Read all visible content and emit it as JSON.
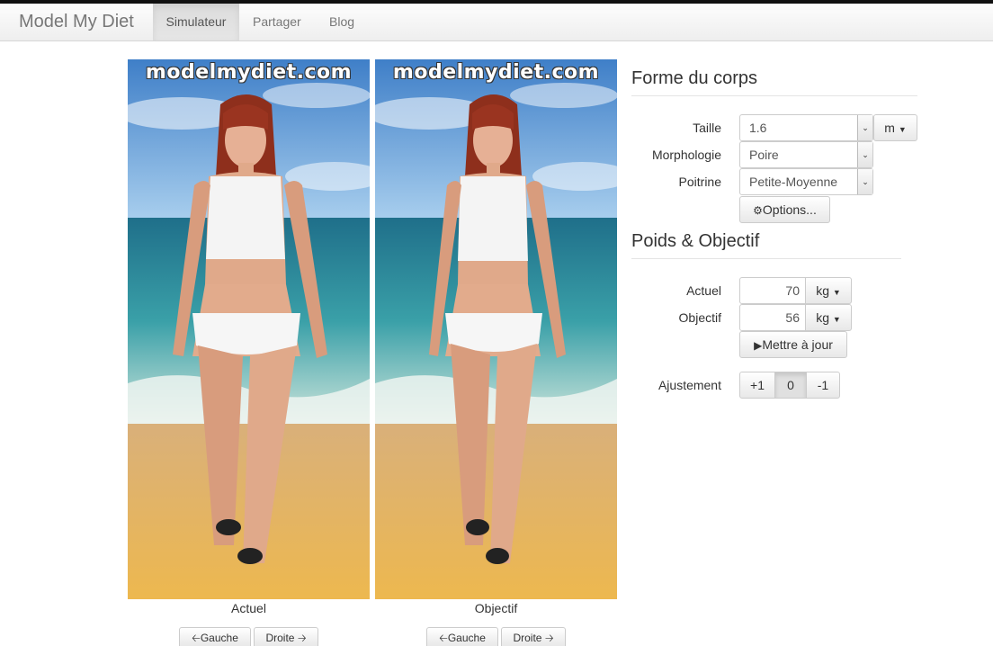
{
  "navbar": {
    "brand": "Model My Diet",
    "items": [
      {
        "label": "Simulateur",
        "active": true
      },
      {
        "label": "Partager",
        "active": false
      },
      {
        "label": "Blog",
        "active": false
      }
    ]
  },
  "models": [
    {
      "watermark": "modelmydiet.com",
      "caption": "Actuel",
      "left_label": "Gauche",
      "right_label": "Droite"
    },
    {
      "watermark": "modelmydiet.com",
      "caption": "Objectif",
      "left_label": "Gauche",
      "right_label": "Droite"
    }
  ],
  "body_shape": {
    "title": "Forme du corps",
    "height_label": "Taille",
    "height_value": "1.6",
    "height_unit": "m",
    "morph_label": "Morphologie",
    "morph_value": "Poire",
    "bust_label": "Poitrine",
    "bust_value": "Petite-Moyenne",
    "options_label": "Options..."
  },
  "weight": {
    "title": "Poids & Objectif",
    "current_label": "Actuel",
    "current_value": "70",
    "current_unit": "kg",
    "goal_label": "Objectif",
    "goal_value": "56",
    "goal_unit": "kg",
    "update_label": "Mettre à jour"
  },
  "adjust": {
    "label": "Ajustement",
    "buttons": [
      "+1",
      "0",
      "-1"
    ],
    "active": "0"
  },
  "icons": {
    "caret": "caret-down-icon",
    "gear": "gear-icon",
    "play": "play-icon",
    "arrow_left": "arrow-left-icon",
    "arrow_right": "arrow-right-icon"
  },
  "colors": {
    "sky": "#4f8fd0",
    "sea": "#3aa0a8",
    "sand": "#e8b45c",
    "skin": "#e0a98a",
    "hair": "#8e2f1c"
  }
}
